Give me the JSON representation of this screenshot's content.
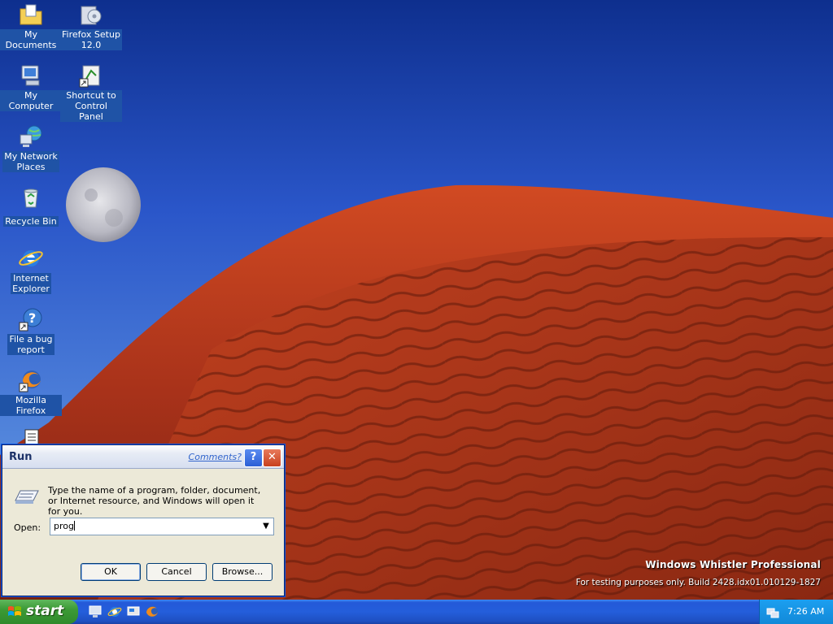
{
  "desktop": {
    "icons": [
      {
        "label_line1": "My Documents",
        "label_line2": "",
        "icon": "folder-documents-icon"
      },
      {
        "label_line1": "Firefox Setup",
        "label_line2": "12.0",
        "icon": "firefox-setup-icon"
      },
      {
        "label_line1": "My Computer",
        "label_line2": "",
        "icon": "computer-icon"
      },
      {
        "label_line1": "Shortcut to",
        "label_line2": "Control Panel",
        "icon": "control-panel-shortcut-icon"
      },
      {
        "label_line1": "My Network",
        "label_line2": "Places",
        "icon": "network-places-icon"
      },
      {
        "label_line1": "Recycle Bin",
        "label_line2": "",
        "icon": "recycle-bin-icon"
      },
      {
        "label_line1": "Internet",
        "label_line2": "Explorer",
        "icon": "internet-explorer-icon"
      },
      {
        "label_line1": "File a bug",
        "label_line2": "report",
        "icon": "help-bug-report-icon"
      },
      {
        "label_line1": "Mozilla Firefox",
        "label_line2": "",
        "icon": "firefox-icon"
      }
    ],
    "watermark": {
      "title": "Windows Whistler Professional",
      "build": "For testing purposes only. Build 2428.idx01.010129-1827"
    }
  },
  "run_dialog": {
    "title": "Run",
    "comments_link": "Comments?",
    "help_glyph": "?",
    "close_glyph": "✕",
    "description": "Type the name of a program, folder, document, or Internet resource, and Windows will open it for you.",
    "open_label": "Open:",
    "open_value": "prog",
    "ok_label": "OK",
    "cancel_label": "Cancel",
    "browse_label": "Browse..."
  },
  "taskbar": {
    "start_label": "start",
    "quick_launch": [
      "monitor-icon",
      "internet-explorer-icon",
      "show-desktop-icon",
      "firefox-icon"
    ],
    "clock": "7:26 AM"
  },
  "colors": {
    "sky": "#2a56c9",
    "dune": "#b8341a",
    "taskbar": "#245edb",
    "start": "#3c9a36"
  }
}
